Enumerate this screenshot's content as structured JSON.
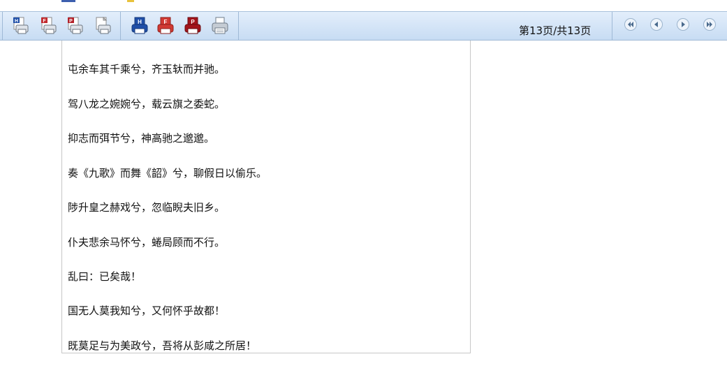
{
  "toolbar": {
    "left_buttons": [
      {
        "icon": "print-html-icon",
        "letter": "H",
        "color": "#1f4fa8"
      },
      {
        "icon": "print-pdf-icon",
        "letter": "F",
        "color": "#c0282d"
      },
      {
        "icon": "print-ppt-icon",
        "letter": "P",
        "color": "#c0282d"
      },
      {
        "icon": "print-plain-icon",
        "letter": "",
        "color": "#777777"
      }
    ],
    "right_buttons": [
      {
        "icon": "export-html-icon",
        "letter": "H",
        "color": "#1f4fa8"
      },
      {
        "icon": "export-pdf-icon",
        "letter": "F",
        "color": "#c0282d"
      },
      {
        "icon": "export-ppt-icon",
        "letter": "P",
        "color": "#c0282d"
      },
      {
        "icon": "printer-icon",
        "letter": "",
        "color": "#6f7b88"
      }
    ],
    "page_indicator": "第13页/共13页",
    "nav": {
      "first": "first-page-icon",
      "prev": "previous-page-icon",
      "next": "next-page-icon",
      "last": "last-page-icon"
    }
  },
  "document": {
    "lines": [
      "屯余车其千乘兮，齐玉轪而并驰。",
      "驾八龙之婉婉兮，载云旗之委蛇。",
      "抑志而弭节兮，神高驰之邈邈。",
      "奏《九歌》而舞《韶》兮，聊假日以偷乐。",
      "陟升皇之赫戏兮，忽临睨夫旧乡。",
      "仆夫悲余马怀兮，蜷局顾而不行。",
      "乱曰：已矣哉！",
      "国无人莫我知兮，又何怀乎故都！",
      "既莫足与为美政兮，吾将从彭咸之所居！"
    ]
  },
  "colors": {
    "toolbar_top": "#e3eefb",
    "toolbar_bottom": "#c7dcf3",
    "border": "#9fb9d6",
    "blue_icon": "#1f4fa8",
    "red_icon": "#c0282d"
  }
}
